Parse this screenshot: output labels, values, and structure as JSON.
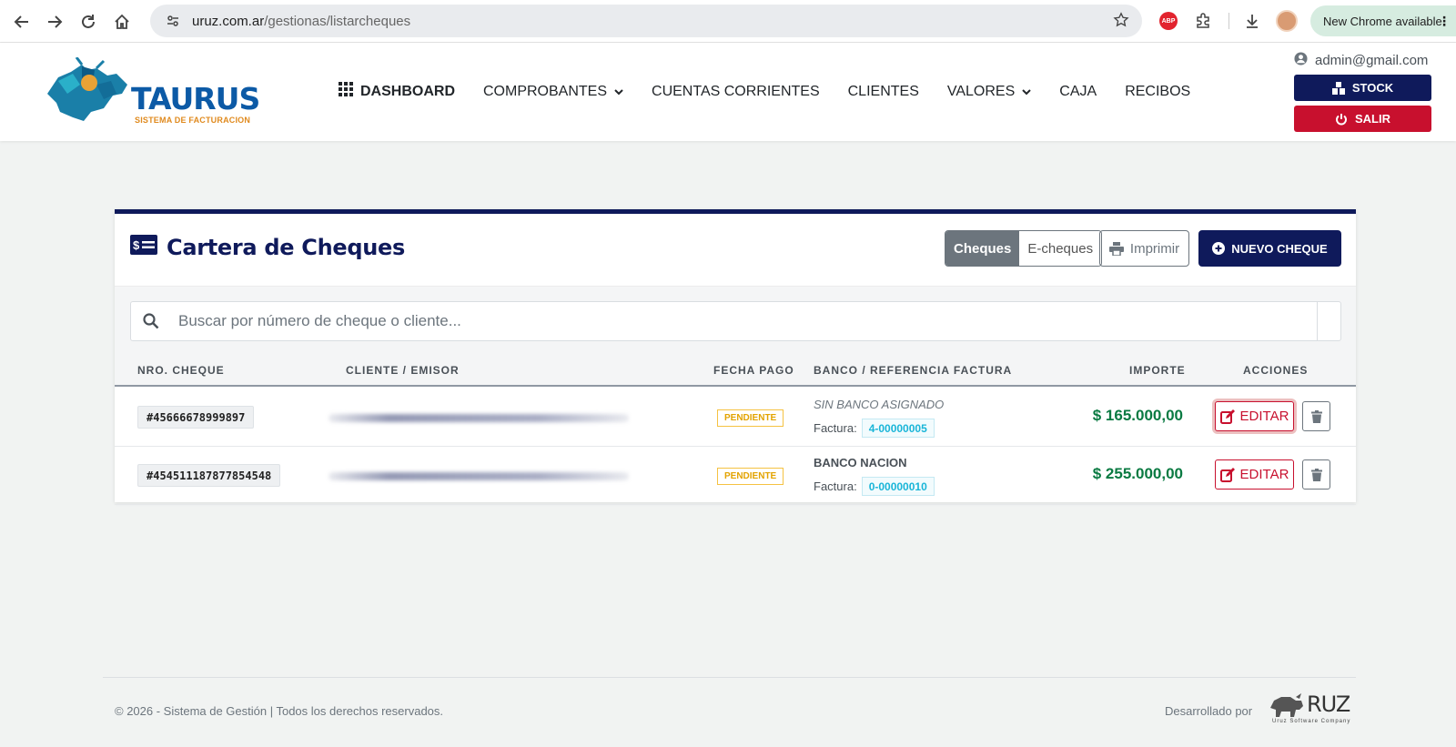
{
  "browser": {
    "url_host": "uruz.com.ar",
    "url_path": "/gestionas/listarcheques",
    "abp_label": "ABP",
    "update_label": "New Chrome available"
  },
  "header": {
    "logo_text": "TAURUS",
    "logo_subtitle": "SISTEMA DE FACTURACION",
    "nav": {
      "dashboard": "DASHBOARD",
      "comprobantes": "COMPROBANTES",
      "cuentas": "CUENTAS CORRIENTES",
      "clientes": "CLIENTES",
      "valores": "VALORES",
      "caja": "CAJA",
      "recibos": "RECIBOS"
    },
    "user_email": "admin@gmail.com",
    "stock_label": "STOCK",
    "salir_label": "SALIR",
    "colors": {
      "navy": "#0f1a5b",
      "red": "#c8102e"
    }
  },
  "card": {
    "title": "Cartera de Cheques",
    "toggle": [
      "Cheques",
      "E-cheques"
    ],
    "toggle_selected": "Cheques",
    "print_label": "Imprimir",
    "new_label": "NUEVO CHEQUE",
    "search_placeholder": "Buscar por número de cheque o cliente...",
    "columns": {
      "nro": "NRO. CHEQUE",
      "cliente": "CLIENTE / EMISOR",
      "fecha": "FECHA PAGO",
      "banco": "BANCO / REFERENCIA FACTURA",
      "importe": "IMPORTE",
      "acciones": "ACCIONES"
    },
    "rows": [
      {
        "nro": "#45666678999897",
        "cliente": "",
        "fecha": "PENDIENTE",
        "banco": "SIN BANCO ASIGNADO",
        "factura_label": "Factura:",
        "factura": "4-00000005",
        "importe": "$ 165.000,00",
        "edit_label": "EDITAR"
      },
      {
        "nro": "#454511187877854548",
        "cliente": "",
        "fecha": "PENDIENTE",
        "banco": "BANCO NACION",
        "factura_label": "Factura:",
        "factura": "0-00000010",
        "importe": "$ 255.000,00",
        "edit_label": "EDITAR"
      }
    ]
  },
  "footer": {
    "copyright": "© 2026 - Sistema de Gestión | Todos los derechos reservados.",
    "developed_by": "Desarrollado por",
    "brand": "RUZ",
    "brand_sub": "Uruz Software Company"
  }
}
